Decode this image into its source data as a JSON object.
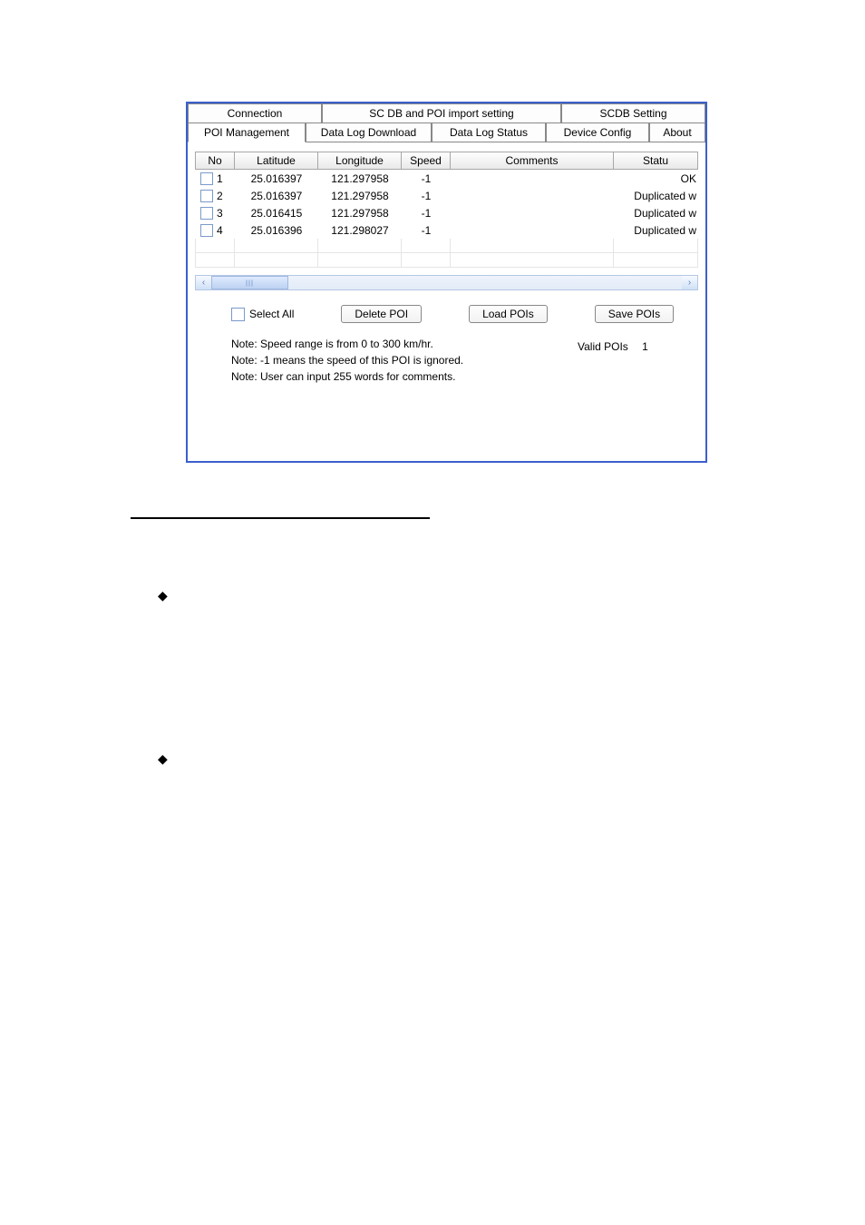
{
  "tabs_row1": {
    "connection": "Connection",
    "scdb_import": "SC DB and POI import setting",
    "scdb_setting": "SCDB  Setting"
  },
  "tabs_row2": {
    "poi_management": "POI Management",
    "data_log_download": "Data Log Download",
    "data_log_status": "Data Log Status",
    "device_config": "Device Config",
    "about": "About"
  },
  "columns": {
    "no": "No",
    "latitude": "Latitude",
    "longitude": "Longitude",
    "speed": "Speed",
    "comments": "Comments",
    "status": "Statu"
  },
  "rows": [
    {
      "no": "1",
      "latitude": "25.016397",
      "longitude": "121.297958",
      "speed": "-1",
      "comments": "",
      "status": "OK"
    },
    {
      "no": "2",
      "latitude": "25.016397",
      "longitude": "121.297958",
      "speed": "-1",
      "comments": "",
      "status": "Duplicated w"
    },
    {
      "no": "3",
      "latitude": "25.016415",
      "longitude": "121.297958",
      "speed": "-1",
      "comments": "",
      "status": "Duplicated w"
    },
    {
      "no": "4",
      "latitude": "25.016396",
      "longitude": "121.298027",
      "speed": "-1",
      "comments": "",
      "status": "Duplicated w"
    }
  ],
  "controls": {
    "select_all": "Select All",
    "delete_poi": "Delete POI",
    "load_pois": "Load POIs",
    "save_pois": "Save POIs"
  },
  "valid_pois": {
    "label": "Valid POIs",
    "value": "1"
  },
  "notes": {
    "n1": "Note: Speed range is from 0 to 300 km/hr.",
    "n2": "Note: -1 means the speed of this POI is ignored.",
    "n3": "Note:  User can input 255 words for comments."
  },
  "glyphs": {
    "left_arrow": "‹",
    "right_arrow": "›",
    "diamond": "◆"
  }
}
